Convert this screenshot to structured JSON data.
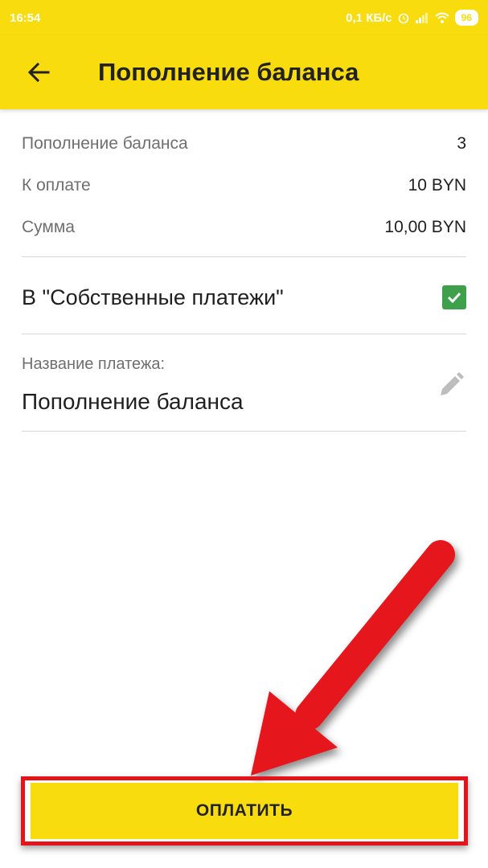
{
  "status_bar": {
    "time": "16:54",
    "net_speed": "0,1 КБ/с",
    "battery": "96"
  },
  "header": {
    "title": "Пополнение баланса"
  },
  "summary": [
    {
      "label": "Пополнение баланса",
      "value": "3"
    },
    {
      "label": "К оплате",
      "value": "10 BYN"
    },
    {
      "label": "Сумма",
      "value": "10,00 BYN"
    }
  ],
  "own_payments": {
    "label": "В \"Собственные платежи\"",
    "checked": true
  },
  "payment_name": {
    "label": "Название платежа:",
    "value": "Пополнение баланса"
  },
  "pay_button": {
    "label": "ОПЛАТИТЬ"
  },
  "colors": {
    "accent_yellow": "#f9dc0e",
    "check_green": "#3ea04b",
    "annotation_red": "#e5141b"
  }
}
